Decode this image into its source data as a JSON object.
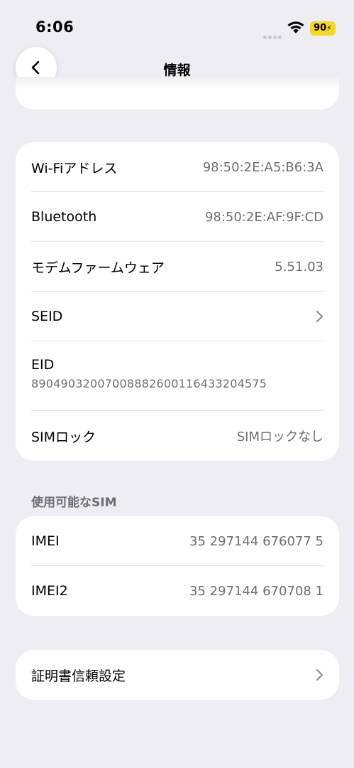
{
  "status_bar": {
    "time": "6:06",
    "battery": "90"
  },
  "header": {
    "title": "情報"
  },
  "network_card": {
    "rows": [
      {
        "label": "Wi-Fiアドレス",
        "value": "98:50:2E:A5:B6:3A"
      },
      {
        "label": "Bluetooth",
        "value": "98:50:2E:AF:9F:CD"
      },
      {
        "label": "モデムファームウェア",
        "value": "5.51.03"
      },
      {
        "label": "SEID"
      },
      {
        "label": "EID",
        "value": "89049032007008882600116433204575"
      },
      {
        "label": "SIMロック",
        "value": "SIMロックなし"
      }
    ]
  },
  "sim_section": {
    "title": "使用可能なSIM",
    "rows": [
      {
        "label": "IMEI",
        "value": "35 297144 676077 5"
      },
      {
        "label": "IMEI2",
        "value": "35 297144 670708 1"
      }
    ]
  },
  "certificate_card": {
    "label": "証明書信頼設定"
  },
  "icons": [
    "back-chevron-icon",
    "wifi-icon",
    "battery-icon",
    "chevron-right-icon"
  ]
}
